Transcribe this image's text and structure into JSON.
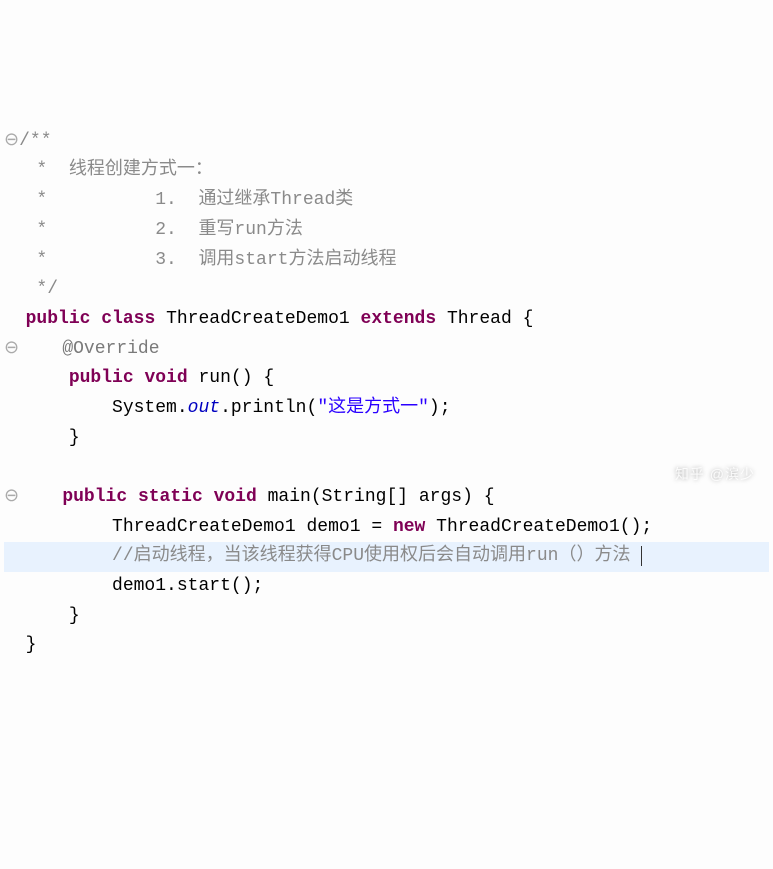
{
  "code": {
    "comment_open": "/**",
    "comment_l1": " *  线程创建方式一：",
    "comment_l2": " *          1.  通过继承Thread类",
    "comment_l3": " *          2.  重写run方法",
    "comment_l4": " *          3.  调用start方法启动线程",
    "comment_close": " */",
    "kw_public": "public",
    "kw_class": "class",
    "kw_extends": "extends",
    "kw_void": "void",
    "kw_static": "static",
    "kw_new": "new",
    "class_name": "ThreadCreateDemo1",
    "super_class": "Thread",
    "annotation_override": "@Override",
    "method_run": "run",
    "method_main": "main",
    "system": "System",
    "out": "out",
    "println": "println",
    "string_val": "\"这是方式一\"",
    "main_params_type": "String",
    "main_params_name": "args",
    "var_name": "demo1",
    "inline_comment": "//启动线程，当该线程获得CPU使用权后会自动调用run（）方法",
    "start_call": "start",
    "lbrace": "{",
    "rbrace": "}",
    "lparen": "(",
    "rparen": ")",
    "lbracket": "[",
    "rbracket": "]",
    "semi": ";",
    "dot": ".",
    "eq": "=",
    "space": " "
  },
  "watermark": "知乎 @滨少"
}
